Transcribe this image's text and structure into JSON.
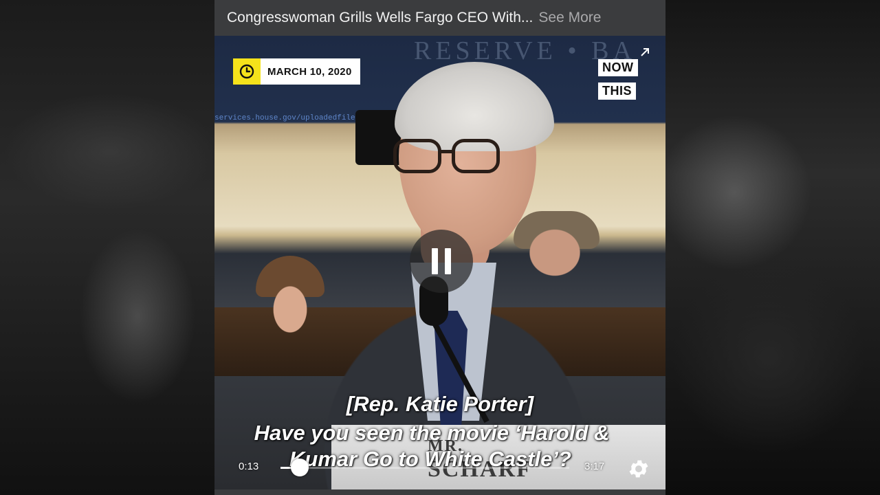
{
  "video": {
    "title": "Congresswoman Grills Wells Fargo CEO With...",
    "see_more_label": "See More",
    "date": "MARCH 10, 2020",
    "brand": {
      "line1": "NOW",
      "line2": "THIS"
    },
    "subtitles": {
      "speaker": "[Rep. Katie Porter]",
      "line1": "Have you seen the movie ‘Harold &",
      "line2": "Kumar Go to White Castle’?"
    },
    "nameplate": {
      "line1": "MR.",
      "line2": "SCHARF"
    },
    "background_text": "RESERVE • BA",
    "url_text": "services.house.gov/uploadedfiles/bills-116",
    "player": {
      "current_time": "0:13",
      "duration": "3:17",
      "progress_fraction": 0.066,
      "state": "playing"
    }
  },
  "icons": {
    "clock": "clock-icon",
    "pause": "pause-icon",
    "settings": "gear-icon",
    "expand": "expand-icon"
  },
  "colors": {
    "date_badge_accent": "#f5e21b",
    "title_bar_bg": "#3b3c3e",
    "see_more": "#a9a9ab"
  }
}
